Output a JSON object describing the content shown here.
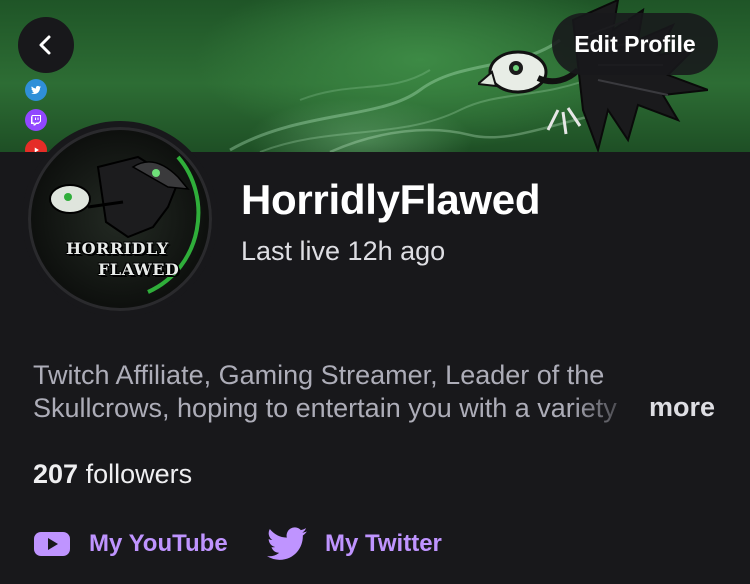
{
  "header": {
    "edit_profile_label": "Edit Profile"
  },
  "profile": {
    "display_name": "HorridlyFlawed",
    "last_live": "Last live 12h ago",
    "avatar_text_line1": "HORRIDLY",
    "avatar_text_line2": "FLAWED",
    "bio_line1": "Twitch Affiliate, Gaming Streamer, Leader of the",
    "bio_line2": "Skullcrows, hoping to entertain you with a variety",
    "more_label": "more",
    "follower_count": "207",
    "followers_label": "followers"
  },
  "social_links": [
    {
      "label": "My YouTube",
      "icon": "youtube-icon"
    },
    {
      "label": "My Twitter",
      "icon": "twitter-icon"
    }
  ],
  "colors": {
    "background": "#18181b",
    "link_purple": "#bf94ff",
    "banner_green": "#2d6d34"
  }
}
